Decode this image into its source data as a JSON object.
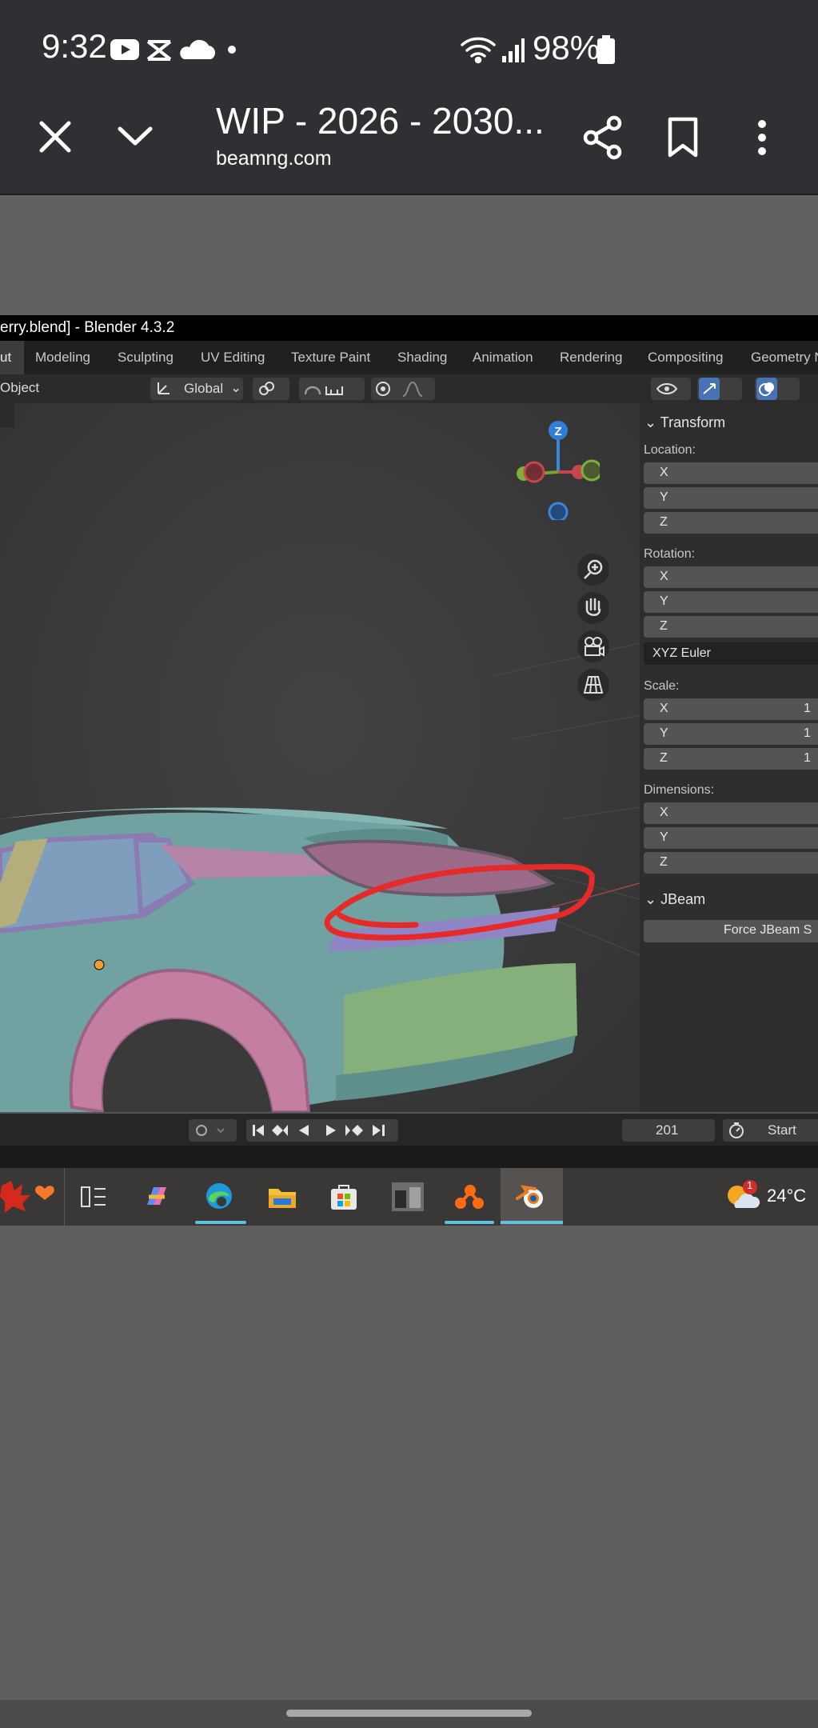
{
  "status_bar": {
    "time": "9:32",
    "battery": "98%"
  },
  "browser": {
    "title": "WIP - 2026 - 2030...",
    "domain": "beamng.com"
  },
  "blender": {
    "window_title": "erry.blend] - Blender 4.3.2",
    "tabs": [
      "ut",
      "Modeling",
      "Sculpting",
      "UV Editing",
      "Texture Paint",
      "Shading",
      "Animation",
      "Rendering",
      "Compositing",
      "Geometry N"
    ],
    "toolbar": {
      "mode": "Object",
      "orientation": "Global"
    },
    "gizmo": {
      "z_label": "Z"
    },
    "n_panel": {
      "transform_header": "Transform",
      "location_label": "Location:",
      "rotation_label": "Rotation:",
      "rotation_mode": "XYZ Euler",
      "scale_label": "Scale:",
      "dimensions_label": "Dimensions:",
      "axes": [
        "X",
        "Y",
        "Z"
      ],
      "scale_values": [
        "1",
        "1",
        "1"
      ],
      "jbeam_header": "JBeam",
      "force_button": "Force JBeam S"
    },
    "timeline": {
      "frame": "201",
      "start_label": "Start"
    }
  },
  "taskbar": {
    "weather_temp": "24°C",
    "weather_badge": "1"
  }
}
